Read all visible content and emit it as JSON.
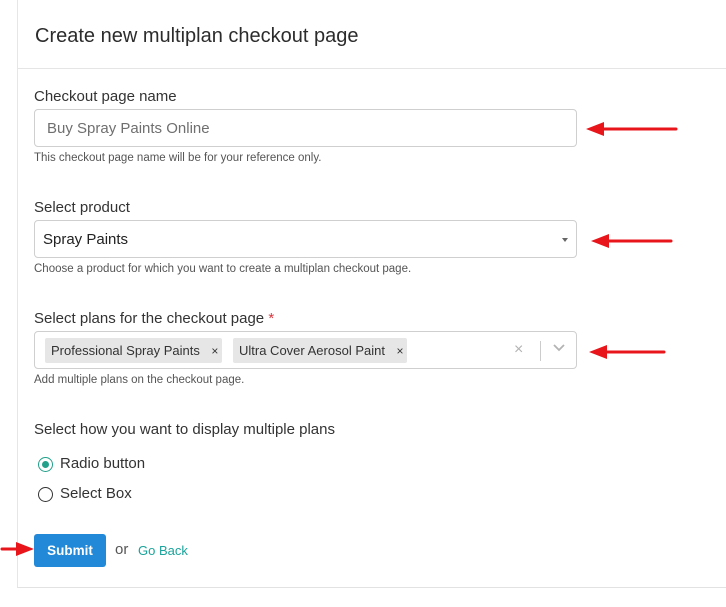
{
  "header": {
    "title": "Create new multiplan checkout page"
  },
  "checkout_name": {
    "label": "Checkout page name",
    "placeholder": "Buy Spray Paints Online",
    "help": "This checkout page name will be for your reference only."
  },
  "product": {
    "label": "Select product",
    "selected": "Spray Paints",
    "help": "Choose a product for which you want to create a multiplan checkout page."
  },
  "plans": {
    "label": "Select plans for the checkout page",
    "required_mark": "*",
    "tags": [
      "Professional Spray Paints",
      "Ultra Cover Aerosol Paint"
    ],
    "remove_glyph": "×",
    "clear_glyph": "×",
    "help": "Add multiple plans on the checkout page."
  },
  "display": {
    "label": "Select how you want to display multiple plans",
    "options": [
      "Radio button",
      "Select Box"
    ],
    "selected": "Radio button"
  },
  "actions": {
    "submit": "Submit",
    "or": "or",
    "go_back": "Go Back"
  },
  "colors": {
    "primary": "#2289d8",
    "link": "#1aa39a",
    "radio_checked": "#21a08a",
    "annotation_arrow": "#e8161b",
    "required": "#d9363e"
  }
}
